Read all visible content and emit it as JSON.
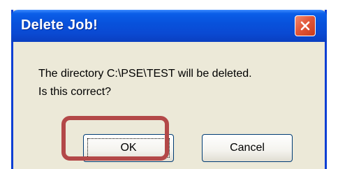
{
  "dialog": {
    "title": "Delete Job!",
    "message_line1": "The directory C:\\PSE\\TEST will be deleted.",
    "message_line2": "Is this correct?",
    "ok_label": "OK",
    "cancel_label": "Cancel",
    "close_icon": "close-icon"
  },
  "colors": {
    "titlebar": "#0852dc",
    "dialog_bg": "#ece9d8",
    "close_button": "#e2583a",
    "highlight": "#b34848"
  }
}
